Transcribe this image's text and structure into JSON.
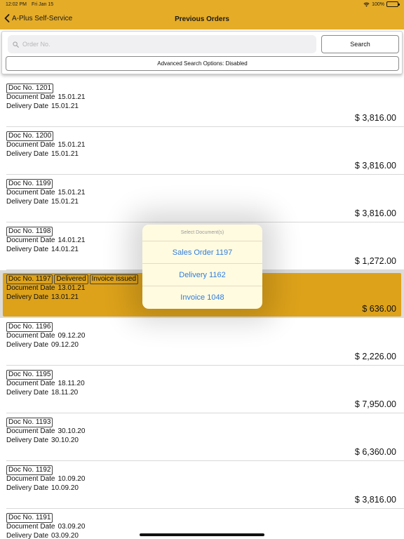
{
  "status_bar": {
    "time": "12:02 PM",
    "date": "Fri Jan 15",
    "battery": "100%"
  },
  "nav": {
    "back_label": "A-Plus Self-Service",
    "title": "Previous Orders"
  },
  "search": {
    "placeholder": "Order No.",
    "value": "",
    "button_label": "Search",
    "advanced_label": "Advanced Search Options: Disabled"
  },
  "labels": {
    "document_date": "Document Date",
    "delivery_date": "Delivery Date"
  },
  "colors": {
    "header": "#E5AC27",
    "selected_row": "#DDA21A",
    "popover_link": "#2f7ce0"
  },
  "orders": [
    {
      "doc": "Doc No. 1201",
      "badges": [],
      "document_date": "15.01.21",
      "delivery_date": "15.01.21",
      "amount": "$ 3,816.00",
      "selected": false
    },
    {
      "doc": "Doc No. 1200",
      "badges": [],
      "document_date": "15.01.21",
      "delivery_date": "15.01.21",
      "amount": "$ 3,816.00",
      "selected": false
    },
    {
      "doc": "Doc No. 1199",
      "badges": [],
      "document_date": "15.01.21",
      "delivery_date": "15.01.21",
      "amount": "$ 3,816.00",
      "selected": false
    },
    {
      "doc": "Doc No. 1198",
      "badges": [],
      "document_date": "14.01.21",
      "delivery_date": "14.01.21",
      "amount": "$ 1,272.00",
      "selected": false
    },
    {
      "doc": "Doc No. 1197",
      "badges": [
        "Delivered",
        "Invoice issued"
      ],
      "document_date": "13.01.21",
      "delivery_date": "13.01.21",
      "amount": "$ 636.00",
      "selected": true
    },
    {
      "doc": "Doc No. 1196",
      "badges": [],
      "document_date": "09.12.20",
      "delivery_date": "09.12.20",
      "amount": "$ 2,226.00",
      "selected": false
    },
    {
      "doc": "Doc No. 1195",
      "badges": [],
      "document_date": "18.11.20",
      "delivery_date": "18.11.20",
      "amount": "$ 7,950.00",
      "selected": false
    },
    {
      "doc": "Doc No. 1193",
      "badges": [],
      "document_date": "30.10.20",
      "delivery_date": "30.10.20",
      "amount": "$ 6,360.00",
      "selected": false
    },
    {
      "doc": "Doc No. 1192",
      "badges": [],
      "document_date": "10.09.20",
      "delivery_date": "10.09.20",
      "amount": "$ 3,816.00",
      "selected": false
    },
    {
      "doc": "Doc No. 1191",
      "badges": [],
      "document_date": "03.09.20",
      "delivery_date": "03.09.20",
      "amount": "",
      "selected": false
    }
  ],
  "popover": {
    "title": "Select Document(s)",
    "items": [
      "Sales Order 1197",
      "Delivery 1162",
      "Invoice 1048"
    ]
  }
}
